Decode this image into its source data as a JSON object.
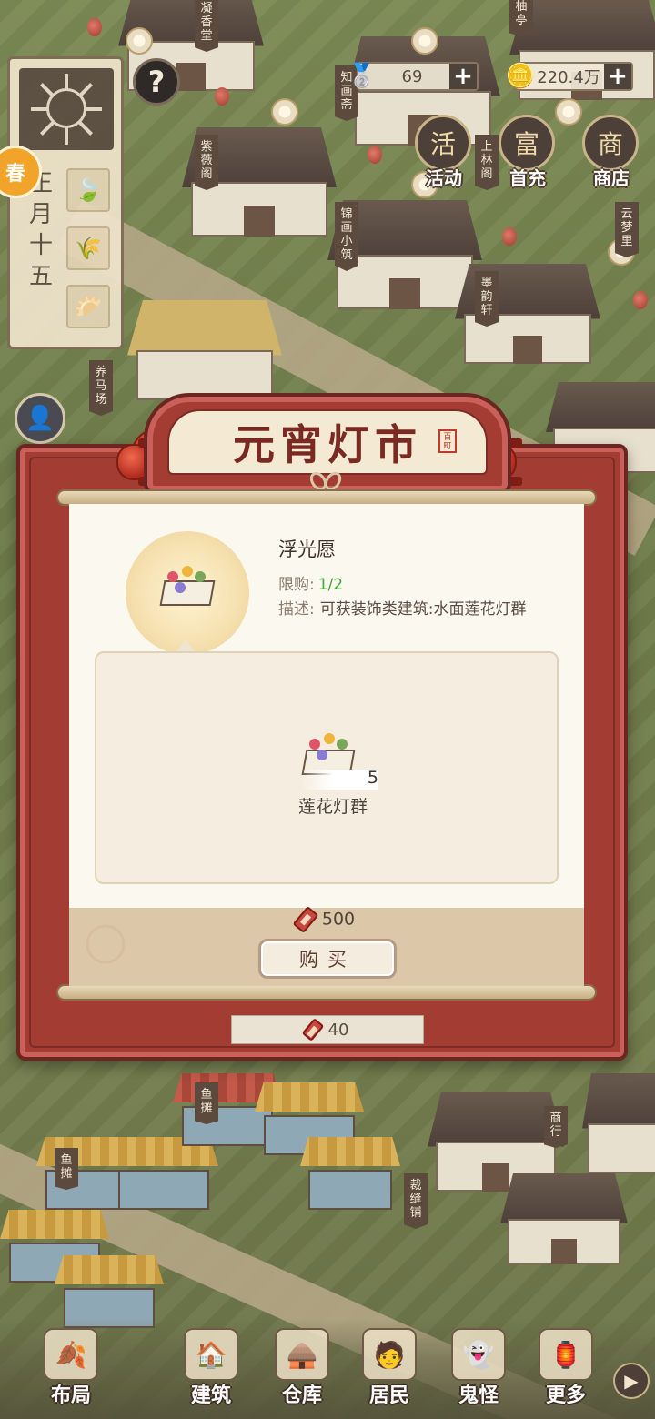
{
  "hud": {
    "date_text": "正月十五",
    "season_badge": "春",
    "resources": [
      {
        "icon": "ingot-icon",
        "value": "69"
      },
      {
        "icon": "copper-coin-icon",
        "value": "220.4万"
      }
    ],
    "top_buttons": [
      {
        "id": "activity",
        "label": "活动",
        "glyph": "活"
      },
      {
        "id": "first-recharge",
        "label": "首充",
        "glyph": "富"
      },
      {
        "id": "shop",
        "label": "商店",
        "glyph": "商"
      }
    ],
    "help_glyph": "?"
  },
  "map_labels": [
    "凝香堂",
    "知画斋",
    "紫薇阁",
    "锦画小筑",
    "上林阁",
    "墨韵轩",
    "云梦里",
    "柚亭",
    "养马场",
    "鱼摊",
    "鱼摊",
    "裁缝铺",
    "商行"
  ],
  "modal": {
    "title": "元宵灯市",
    "seal_text": "百町",
    "item": {
      "name": "浮光愿",
      "limit_label": "限购:",
      "limit_value": "1/2",
      "desc_label": "描述:",
      "desc_text": "可获装饰类建筑:水面莲花灯群"
    },
    "reward": {
      "name": "莲花灯群",
      "count": "5"
    },
    "price": "500",
    "buy_label": "购买",
    "balance": "40"
  },
  "nav": [
    {
      "id": "layout",
      "label": "布局"
    },
    {
      "id": "build",
      "label": "建筑"
    },
    {
      "id": "warehouse",
      "label": "仓库"
    },
    {
      "id": "residents",
      "label": "居民"
    },
    {
      "id": "ghosts",
      "label": "鬼怪"
    },
    {
      "id": "more",
      "label": "更多"
    }
  ],
  "colors": {
    "frame_red": "#a33c33",
    "limit_green": "#4aa43a",
    "scroll_paper": "#fbf8f0"
  }
}
